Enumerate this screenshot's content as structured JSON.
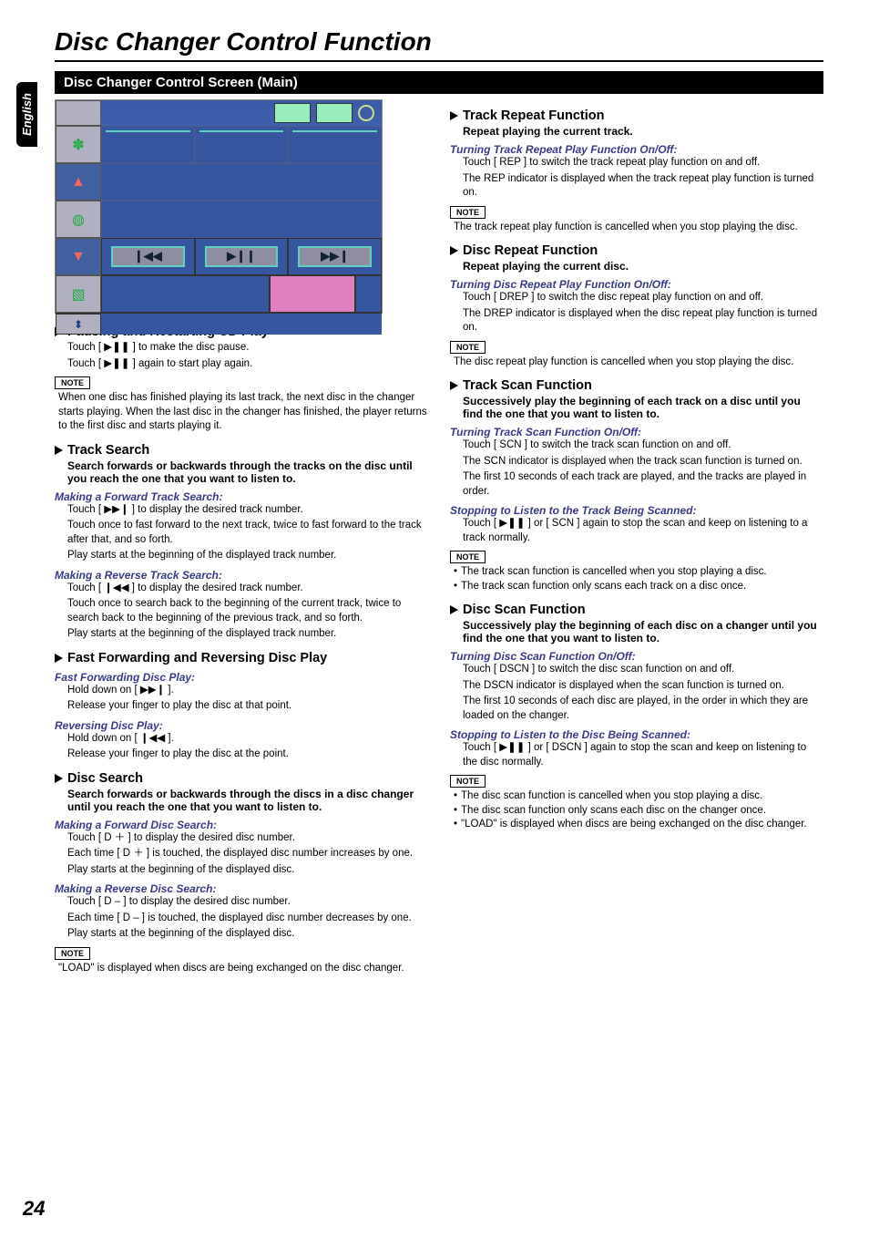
{
  "page": {
    "title": "Disc Changer Control Function",
    "side_tab": "English",
    "section_bar": "Disc Changer Control Screen (Main)",
    "page_number": "24",
    "note_label": "NOTE"
  },
  "left": {
    "pausing": {
      "heading": "Pausing and Restarting CD Play",
      "line1": "Touch [ ▶❚❚ ] to make the disc pause.",
      "line2": "Touch [ ▶❚❚ ] again to start play again.",
      "note": "When one disc has finished playing its last track, the next disc in the changer starts playing. When the last disc in the changer has finished, the player returns to the first disc and starts playing it."
    },
    "track_search": {
      "heading": "Track Search",
      "intro": "Search forwards or backwards through the tracks on the disc until you reach the one that you want to listen to.",
      "fwd_h": "Making a Forward Track Search:",
      "fwd_1": "Touch [ ▶▶❙ ] to display the desired track number.",
      "fwd_2": "Touch once to fast forward to the next track, twice to fast forward to the track after that, and so forth.",
      "fwd_3": "Play starts at the beginning of the displayed track number.",
      "rev_h": "Making a Reverse Track Search:",
      "rev_1": "Touch [ ❙◀◀ ] to display the desired track number.",
      "rev_2": "Touch once to search back to the beginning of the current track, twice to search back to the beginning of the previous track, and so forth.",
      "rev_3": "Play starts at the beginning of the displayed track number."
    },
    "ffrev": {
      "heading": "Fast Forwarding and Reversing Disc Play",
      "ff_h": "Fast Forwarding Disc Play:",
      "ff_1": "Hold down on [ ▶▶❙ ].",
      "ff_2": "Release your finger to play the disc at that point.",
      "rv_h": "Reversing Disc Play:",
      "rv_1": "Hold down on [ ❙◀◀ ].",
      "rv_2": "Release your finger to play the disc at the point."
    },
    "disc_search": {
      "heading": "Disc Search",
      "intro": "Search forwards or backwards through the discs in a disc changer until you reach the one that you want to listen to.",
      "fwd_h": "Making a Forward Disc Search:",
      "fwd_1": "Touch [ D ＋ ] to display the desired disc number.",
      "fwd_2": "Each time [ D ＋ ] is touched, the displayed disc number increases by one.",
      "fwd_3": "Play starts at the beginning of the displayed disc.",
      "rev_h": "Making a Reverse Disc Search:",
      "rev_1": "Touch [ D – ] to display the desired disc number.",
      "rev_2": "Each time [ D – ] is touched, the displayed disc number decreases by one.",
      "rev_3": "Play starts at the beginning of the displayed disc.",
      "note": "\"LOAD\" is displayed when discs are being exchanged on the disc changer."
    }
  },
  "right": {
    "track_repeat": {
      "heading": "Track Repeat Function",
      "sub": "Repeat playing the current track.",
      "onoff_h": "Turning Track Repeat Play Function On/Off:",
      "line1": "Touch [ REP ] to switch the track repeat play function on and off.",
      "line2": "The REP indicator is displayed when the track repeat play function is turned on.",
      "note": "The track repeat play function is cancelled when you stop playing the disc."
    },
    "disc_repeat": {
      "heading": "Disc Repeat Function",
      "sub": "Repeat playing the current disc.",
      "onoff_h": "Turning Disc Repeat Play Function On/Off:",
      "line1": "Touch [ DREP ] to switch the disc repeat play function on and off.",
      "line2": "The DREP indicator is displayed when the disc repeat play function is turned on.",
      "note": "The disc repeat play function is cancelled when you stop playing the disc."
    },
    "track_scan": {
      "heading": "Track Scan Function",
      "sub": "Successively play the beginning of each track on a disc until you find the one that you want to listen to.",
      "onoff_h": "Turning Track Scan Function On/Off:",
      "line1": "Touch [ SCN ] to switch the track scan function on and off.",
      "line2": "The SCN indicator is displayed when the track scan function is turned on.",
      "line3": "The first 10 seconds of each track are played, and the tracks are played in order.",
      "stop_h": "Stopping to Listen to the Track Being Scanned:",
      "stop_1": "Touch [ ▶❚❚ ] or [ SCN ] again to stop the scan and keep on listening to a track normally.",
      "bullet1": "The track scan function is cancelled when you stop playing a disc.",
      "bullet2": "The track scan function only scans each track on a disc once."
    },
    "disc_scan": {
      "heading": "Disc Scan Function",
      "sub": "Successively play the beginning of each disc on a changer until you find the one that you want to listen to.",
      "onoff_h": "Turning Disc Scan Function On/Off:",
      "line1": "Touch [ DSCN ] to switch the disc scan function on and off.",
      "line2": "The DSCN indicator is displayed when the scan function is turned on.",
      "line3": "The first 10 seconds of each disc are played, in the order in which they are loaded on the changer.",
      "stop_h": "Stopping to Listen to the Disc Being Scanned:",
      "stop_1": "Touch [ ▶❚❚ ] or [ DSCN ] again to stop the scan and keep on listening to the disc normally.",
      "bullet1": "The disc scan function is cancelled when you stop playing a disc.",
      "bullet2": "The disc scan function only scans each disc on the changer once.",
      "bullet3": "\"LOAD\" is displayed when discs are being exchanged on the disc changer."
    }
  }
}
